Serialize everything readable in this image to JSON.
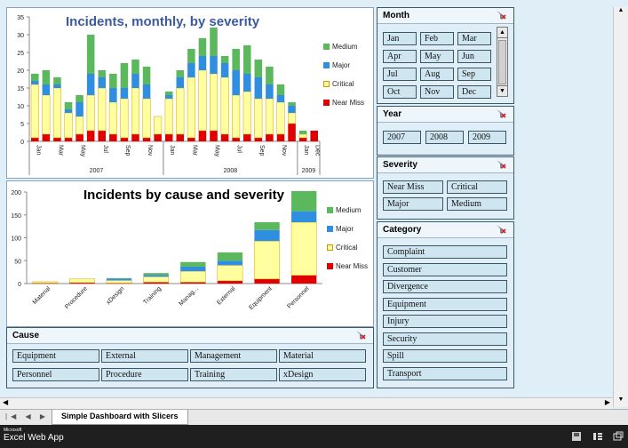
{
  "chart1": {
    "title": "Incidents, monthly, by severity",
    "y_ticks": [
      "35",
      "30",
      "25",
      "20",
      "15",
      "10",
      "5",
      "0"
    ],
    "month_labels": [
      "Jan",
      "Mar",
      "May",
      "Jul",
      "Sep",
      "Nov",
      "Jan",
      "Mar",
      "May",
      "Jul",
      "Sep",
      "Nov",
      "Jan",
      "Dec"
    ],
    "year_labels": [
      "2007",
      "2008",
      "2009"
    ],
    "legend": [
      "Medium",
      "Major",
      "Critical",
      "Near Miss"
    ]
  },
  "chart2": {
    "title": "Incidents by cause and severity",
    "y_ticks": [
      "200",
      "150",
      "100",
      "50",
      "0"
    ],
    "categories": [
      "Material",
      "Procedure",
      "xDesign",
      "Training",
      "Manag...",
      "External",
      "Equipment",
      "Personnel"
    ],
    "legend": [
      "Medium",
      "Major",
      "Critical",
      "Near Miss"
    ]
  },
  "colors": {
    "medium": "#5cb85c",
    "major": "#2f8ee0",
    "critical": "#ffffa0",
    "near_miss": "#e00000",
    "title": "#3b5aa0"
  },
  "chart_data": [
    {
      "type": "bar",
      "title": "Incidents, monthly, by severity",
      "xlabel": "",
      "ylabel": "",
      "ylim": [
        0,
        35
      ],
      "categories": [
        "Jan 2007",
        "Feb 2007",
        "Mar 2007",
        "Apr 2007",
        "May 2007",
        "Jun 2007",
        "Jul 2007",
        "Aug 2007",
        "Sep 2007",
        "Oct 2007",
        "Nov 2007",
        "Dec 2007",
        "Jan 2008",
        "Feb 2008",
        "Mar 2008",
        "Apr 2008",
        "May 2008",
        "Jun 2008",
        "Jul 2008",
        "Aug 2008",
        "Sep 2008",
        "Oct 2008",
        "Nov 2008",
        "Dec 2008",
        "Jan 2009",
        "Feb 2009"
      ],
      "series": [
        {
          "name": "Near Miss",
          "values": [
            1,
            2,
            1,
            1,
            2,
            3,
            3,
            2,
            1,
            2,
            1,
            2,
            2,
            2,
            1,
            3,
            3,
            2,
            1,
            2,
            1,
            2,
            2,
            5,
            1,
            3
          ]
        },
        {
          "name": "Critical",
          "values": [
            15,
            11,
            14,
            7,
            5,
            10,
            12,
            9,
            11,
            13,
            11,
            5,
            10,
            13,
            17,
            17,
            16,
            16,
            12,
            12,
            11,
            10,
            9,
            3,
            1,
            0
          ]
        },
        {
          "name": "Major",
          "values": [
            1,
            3,
            1,
            1,
            4,
            6,
            3,
            4,
            3,
            4,
            4,
            0,
            1,
            3,
            4,
            4,
            5,
            4,
            7,
            5,
            6,
            4,
            2,
            2,
            0,
            0
          ]
        },
        {
          "name": "Medium",
          "values": [
            2,
            4,
            2,
            2,
            2,
            11,
            2,
            4,
            7,
            4,
            5,
            0,
            1,
            2,
            4,
            5,
            8,
            2,
            6,
            8,
            5,
            5,
            3,
            1,
            1,
            0
          ]
        }
      ]
    },
    {
      "type": "bar",
      "title": "Incidents by cause and severity",
      "xlabel": "",
      "ylabel": "",
      "ylim": [
        0,
        200
      ],
      "categories": [
        "Material",
        "Procedure",
        "xDesign",
        "Training",
        "Manag...",
        "External",
        "Equipment",
        "Personnel"
      ],
      "series": [
        {
          "name": "Near Miss",
          "values": [
            1,
            2,
            1,
            3,
            3,
            6,
            10,
            18
          ]
        },
        {
          "name": "Critical",
          "values": [
            3,
            8,
            6,
            12,
            24,
            34,
            83,
            116
          ]
        },
        {
          "name": "Major",
          "values": [
            0,
            0,
            4,
            4,
            10,
            10,
            24,
            24
          ]
        },
        {
          "name": "Medium",
          "values": [
            0,
            0,
            1,
            4,
            10,
            18,
            17,
            44
          ]
        }
      ]
    }
  ],
  "slicers": {
    "month": {
      "title": "Month",
      "items": [
        "Jan",
        "Feb",
        "Mar",
        "Apr",
        "May",
        "Jun",
        "Jul",
        "Aug",
        "Sep",
        "Oct",
        "Nov",
        "Dec"
      ]
    },
    "year": {
      "title": "Year",
      "items": [
        "2007",
        "2008",
        "2009"
      ]
    },
    "severity": {
      "title": "Severity",
      "items": [
        "Near Miss",
        "Critical",
        "Major",
        "Medium"
      ]
    },
    "category": {
      "title": "Category",
      "items": [
        "Complaint",
        "Customer",
        "Divergence",
        "Equipment",
        "Injury",
        "Security",
        "Spill",
        "Transport"
      ]
    },
    "cause": {
      "title": "Cause",
      "items": [
        "Equipment",
        "External",
        "Management",
        "Material",
        "Personnel",
        "Procedure",
        "Training",
        "xDesign"
      ]
    }
  },
  "sheet_tab": "Simple Dashboard with Slicers",
  "status": {
    "brand_small": "Microsoft",
    "brand_large": "Excel Web App"
  }
}
